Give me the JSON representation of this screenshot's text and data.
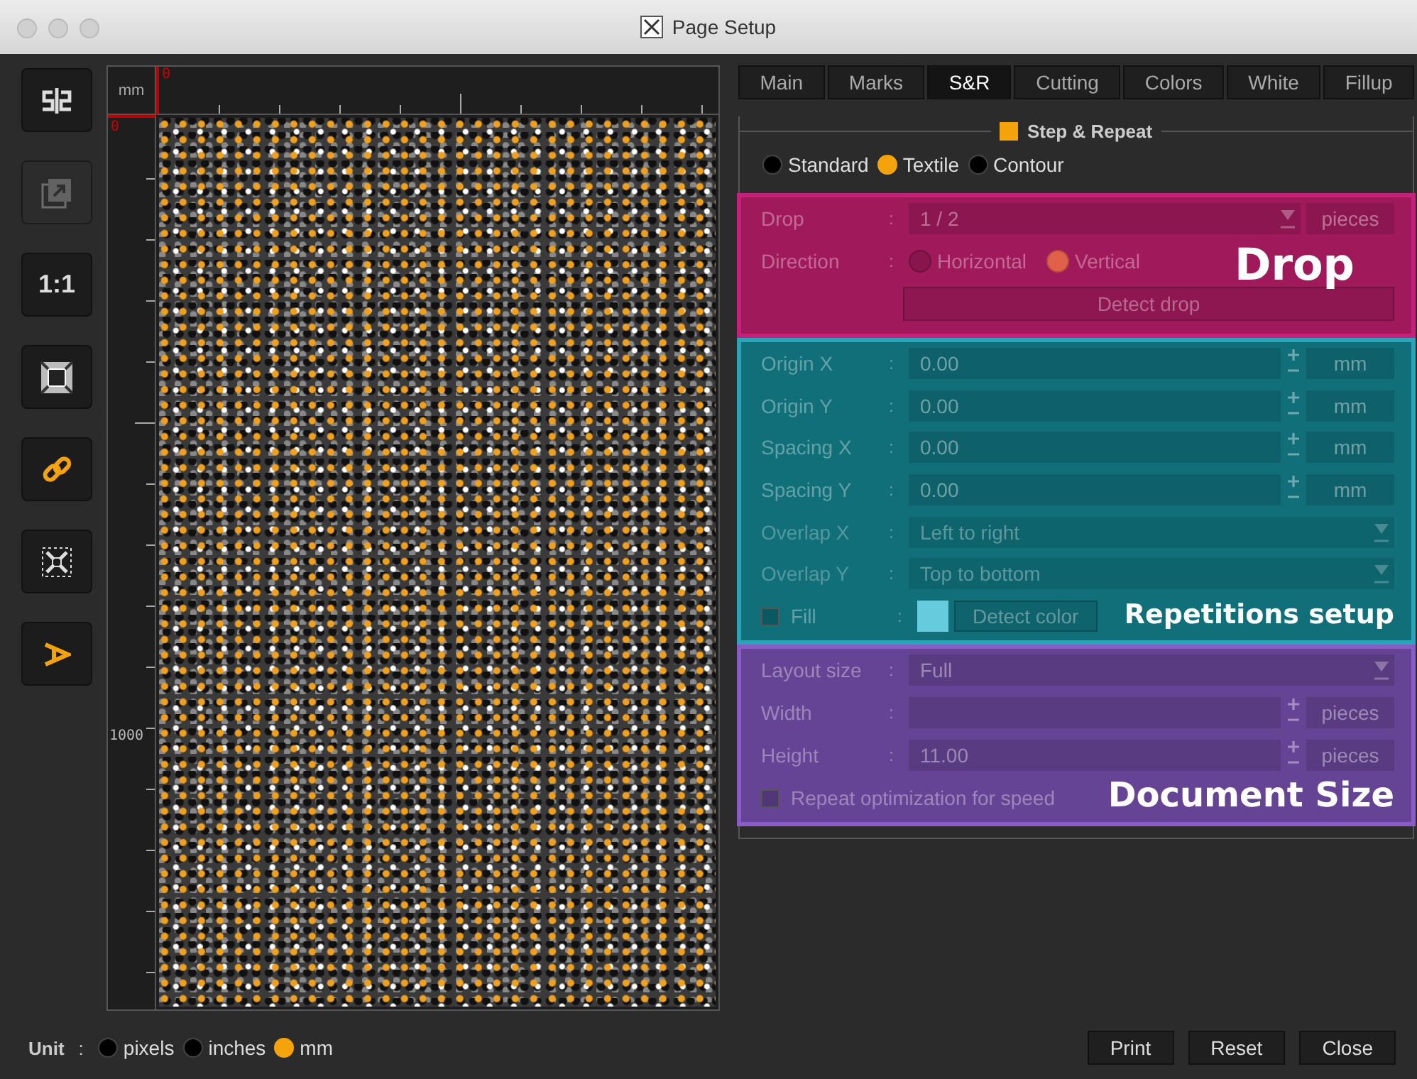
{
  "window": {
    "title": "Page Setup"
  },
  "toolbar": [
    {
      "kind": "mirror",
      "disabled": false,
      "on": false
    },
    {
      "kind": "export",
      "disabled": true,
      "on": false
    },
    {
      "kind": "text",
      "label": "1:1",
      "disabled": false,
      "on": false
    },
    {
      "kind": "fit",
      "disabled": false,
      "on": false
    },
    {
      "kind": "link",
      "disabled": false,
      "on": true
    },
    {
      "kind": "expand",
      "disabled": false,
      "on": false
    },
    {
      "kind": "rotate",
      "disabled": false,
      "on": true
    }
  ],
  "ruler": {
    "unit": "mm",
    "top_origin": "0",
    "left_origin": "0",
    "left_mark": "1000"
  },
  "tabs": [
    {
      "label": "Main",
      "selected": false
    },
    {
      "label": "Marks",
      "selected": false
    },
    {
      "label": "S&R",
      "selected": true
    },
    {
      "label": "Cutting",
      "selected": false
    },
    {
      "label": "Colors",
      "selected": false
    },
    {
      "label": "White",
      "selected": false
    },
    {
      "label": "Fillup",
      "selected": false
    }
  ],
  "step_repeat": {
    "label": "Step & Repeat",
    "checked": true,
    "modes": [
      {
        "label": "Standard",
        "selected": false
      },
      {
        "label": "Textile",
        "selected": true
      },
      {
        "label": "Contour",
        "selected": false
      }
    ]
  },
  "sections": [
    {
      "kind": "drop",
      "annotation": "Drop",
      "rows": [
        {
          "kind": "combo",
          "label": "Drop",
          "separator": ":",
          "value": "1 / 2",
          "unit": "pieces",
          "disabled": false
        },
        {
          "kind": "radios",
          "label": "Direction",
          "separator": ":",
          "options": [
            {
              "label": "Horizontal",
              "selected": false
            },
            {
              "label": "Vertical",
              "selected": true
            }
          ]
        },
        {
          "kind": "button",
          "label": "Detect drop"
        }
      ]
    },
    {
      "kind": "repetitions",
      "annotation": "Repetitions setup",
      "rows": [
        {
          "kind": "spin",
          "label": "Origin X",
          "separator": ":",
          "value": "0.00",
          "unit": "mm"
        },
        {
          "kind": "spin",
          "label": "Origin Y",
          "separator": ":",
          "value": "0.00",
          "unit": "mm"
        },
        {
          "kind": "spin",
          "label": "Spacing X",
          "separator": ":",
          "value": "0.00",
          "unit": "mm"
        },
        {
          "kind": "spin",
          "label": "Spacing Y",
          "separator": ":",
          "value": "0.00",
          "unit": "mm"
        },
        {
          "kind": "combo",
          "label": "Overlap X",
          "separator": ":",
          "value": "Left to right",
          "disabled": true
        },
        {
          "kind": "combo",
          "label": "Overlap Y",
          "separator": ":",
          "value": "Top to bottom",
          "disabled": true
        },
        {
          "kind": "fill",
          "label": "Fill",
          "separator": ":",
          "checked": false,
          "button": "Detect color"
        }
      ]
    },
    {
      "kind": "document",
      "annotation": "Document Size",
      "rows": [
        {
          "kind": "combo",
          "label": "Layout size",
          "separator": ":",
          "value": "Full",
          "disabled": false
        },
        {
          "kind": "spin",
          "label": "Width",
          "separator": ":",
          "unit": "pieces"
        },
        {
          "kind": "spin",
          "label": "Height",
          "separator": ":",
          "value": "11.00",
          "unit": "pieces"
        },
        {
          "kind": "check",
          "label": "Repeat optimization for speed",
          "checked": false
        }
      ]
    }
  ],
  "unit": {
    "label": "Unit",
    "separator": ":",
    "options": [
      {
        "label": "pixels",
        "selected": false
      },
      {
        "label": "inches",
        "selected": false
      },
      {
        "label": "mm",
        "selected": true
      }
    ]
  },
  "buttons": [
    "Print",
    "Reset",
    "Close"
  ]
}
